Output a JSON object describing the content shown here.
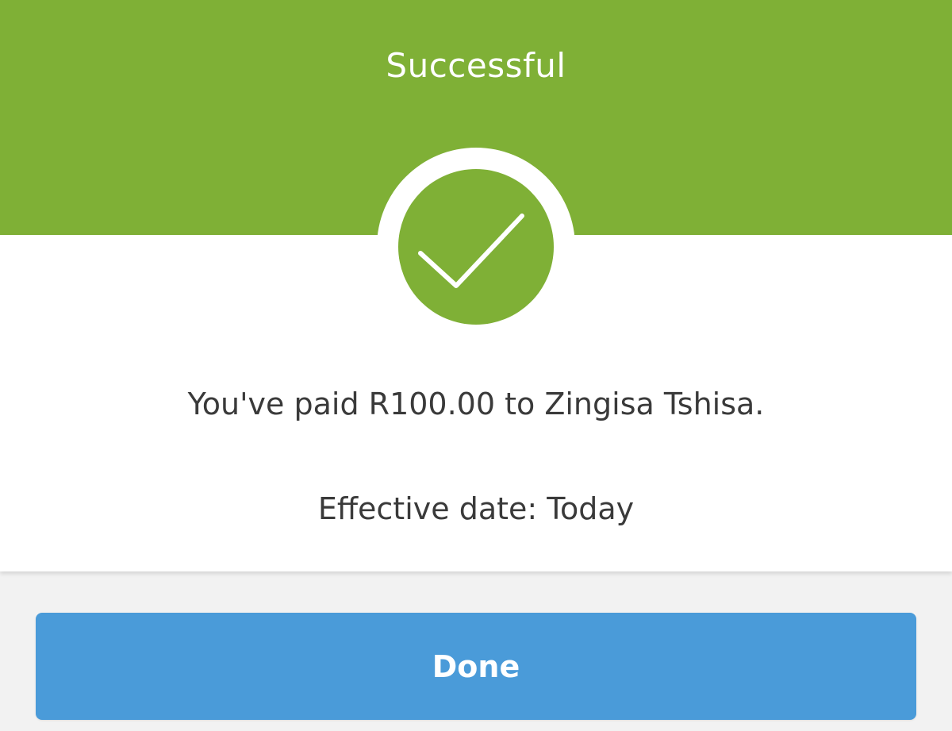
{
  "header": {
    "title": "Successful",
    "color": "#7fb036"
  },
  "status_icon": "check-icon",
  "confirmation": {
    "message": "You've paid R100.00 to Zingisa Tshisa.",
    "effective_date": "Effective date: Today"
  },
  "actions": {
    "done_label": "Done",
    "done_color": "#4a9bd9"
  }
}
